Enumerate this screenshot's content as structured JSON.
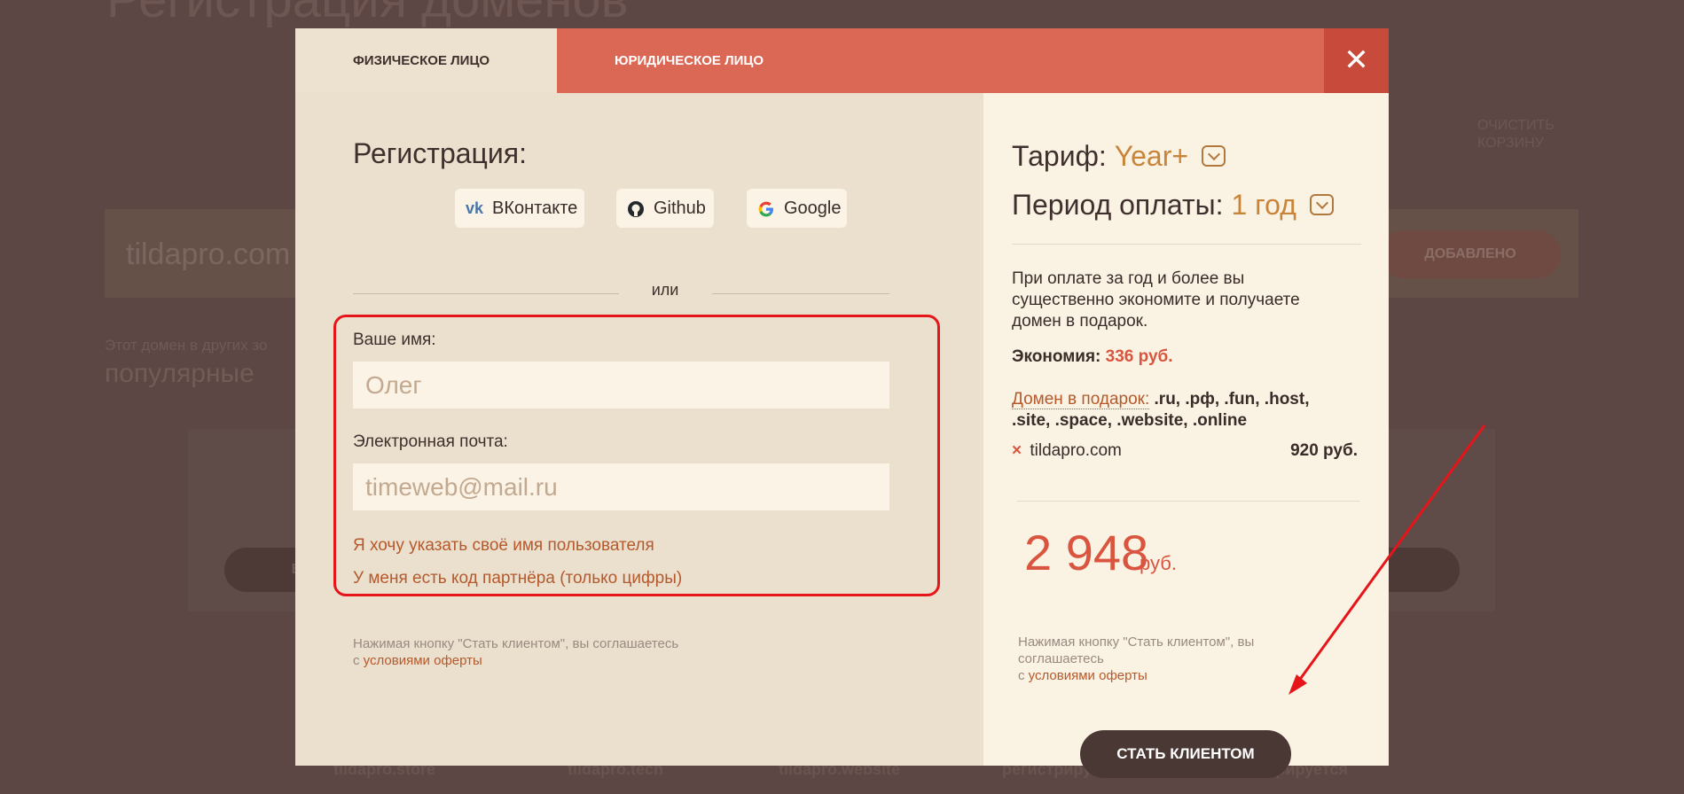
{
  "background": {
    "page_title": "Регистрация доменов",
    "search_value": "tildapro.com",
    "search_button": "ДОБАВЛЕНО",
    "other_zones_label": "Этот домен в других зо",
    "popular_label": "популярные",
    "clear_cart": "ОЧИСТИТЬ КОРЗИНУ",
    "cart_fragment": "ЗИНУ",
    "card_btn": "В КОРЗ",
    "bottom_items": [
      "tildapro.store",
      "tildapro.tech",
      "tildapro.website",
      "регистрируется",
      "регистрируется"
    ]
  },
  "modal": {
    "tabs": [
      "ФИЗИЧЕСКОЕ ЛИЦО",
      "ЮРИДИЧЕСКОЕ ЛИЦО"
    ],
    "close_symbol": "✕",
    "left": {
      "title": "Регистрация:",
      "social": [
        {
          "label": "ВКонтакте",
          "icon": "vk-icon"
        },
        {
          "label": "Github",
          "icon": "github-icon"
        },
        {
          "label": "Google",
          "icon": "google-icon"
        }
      ],
      "or_text": "или",
      "name_label": "Ваше имя:",
      "name_placeholder": "Олег",
      "email_label": "Электронная почта:",
      "email_placeholder": "timeweb@mail.ru",
      "username_link": "Я хочу указать своё имя пользователя",
      "partner_link": "У меня есть код партнёра (только цифры)",
      "terms_text": "Нажимая кнопку \"Стать клиентом\", вы соглашаетесь",
      "terms_prefix": "с",
      "terms_link": "условиями оферты"
    },
    "right": {
      "tariff_label": "Тариф:",
      "tariff_value": "Year+",
      "period_label": "Период оплаты:",
      "period_value": "1 год",
      "info_text": "При оплате за год и более вы существенно экономите и получаете домен в подарок.",
      "savings_label": "Экономия:",
      "savings_value": "336 руб.",
      "gift_label": "Домен в подарок:",
      "gift_zones": ".ru, .рф, .fun, .host, .site, .space, .website, .online",
      "cart_item_remove": "×",
      "cart_item_name": "tildapro.com",
      "cart_item_price": "920 руб.",
      "total_value": "2 948",
      "total_unit": "руб.",
      "terms_text": "Нажимая кнопку \"Стать клиентом\", вы соглашаетесь",
      "terms_prefix": "с",
      "terms_link": "условиями оферты",
      "submit_label": "СТАТЬ КЛИЕНТОМ"
    }
  },
  "colors": {
    "accent": "#db6854",
    "close_bg": "#c84a3a",
    "panel_left": "#ebdfce",
    "panel_right": "#faf2e3",
    "highlight_box": "#e6151a",
    "submit_bg": "#4a3835"
  }
}
